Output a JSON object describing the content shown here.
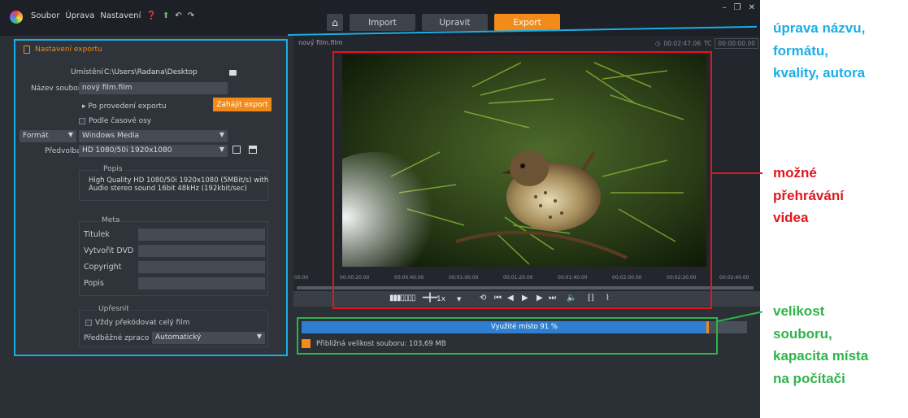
{
  "menu": {
    "items": [
      "Soubor",
      "Úprava",
      "Nastavení"
    ],
    "icons": [
      "help-icon",
      "up-arrow-icon",
      "undo-icon",
      "redo-icon"
    ]
  },
  "nav": {
    "tabs": [
      {
        "label": "Import",
        "active": false
      },
      {
        "label": "Upravit",
        "active": false
      },
      {
        "label": "Export",
        "active": true
      }
    ],
    "accent": "#f28b1a"
  },
  "export_settings": {
    "header": "Nastavení exportu",
    "location_label": "Umístění",
    "location_value": "C:\\Users\\Radana\\Desktop",
    "filename_label": "Název souboru",
    "filename_value": "nový film.film",
    "after_export_label": "Po provedení exportu",
    "start_export_button": "Zahájit export",
    "timeline_checkbox_label": "Podle časové osy",
    "format_label": "Formát",
    "format_value": "Windows Media",
    "preset_label": "Předvolba",
    "preset_value": "HD 1080/50i 1920x1080",
    "description_title": "Popis",
    "description_text_1": "High Quality HD 1080/50i 1920x1080 (5MBit/s) with",
    "description_text_2": "Audio stereo sound 16bit 48kHz (192kbit/sec)",
    "meta_title": "Meta",
    "meta_fields": [
      "Titulek",
      "Vytvořit DVD",
      "Copyright",
      "Popis"
    ],
    "refine_title": "Upřesnit",
    "always_transcode_label": "Vždy překódovat celý film",
    "preprocess_label": "Předběžné zpraco",
    "preprocess_value": "Automatický"
  },
  "preview": {
    "title": "nový film.film",
    "duration": "00:02:47.06",
    "tc_label": "TC",
    "timecode": "00:00:00.00",
    "ruler_labels": [
      "00:00",
      "00:00:20.00",
      "00:00:40.00",
      "00:01:00.00",
      "00:01:20.00",
      "00:01:40.00",
      "00:02:00.00",
      "00:02:20.00",
      "00:02:40.00"
    ],
    "speed": "1x"
  },
  "capacity": {
    "used_label": "Využité místo 91 %",
    "used_fraction": 0.91,
    "approx_size_label": "Přibližná velikost souboru: 103,69 MB"
  },
  "annotations": {
    "cyan": [
      "úprava názvu,",
      "formátu,",
      "kvality, autora"
    ],
    "red": [
      "možné",
      "přehrávání",
      "videa"
    ],
    "green": [
      "velikost",
      "souboru,",
      "kapacita místa",
      "na počítači"
    ],
    "colors": {
      "cyan": "#1aaee6",
      "red": "#e0171f",
      "green": "#2fb34a"
    }
  }
}
